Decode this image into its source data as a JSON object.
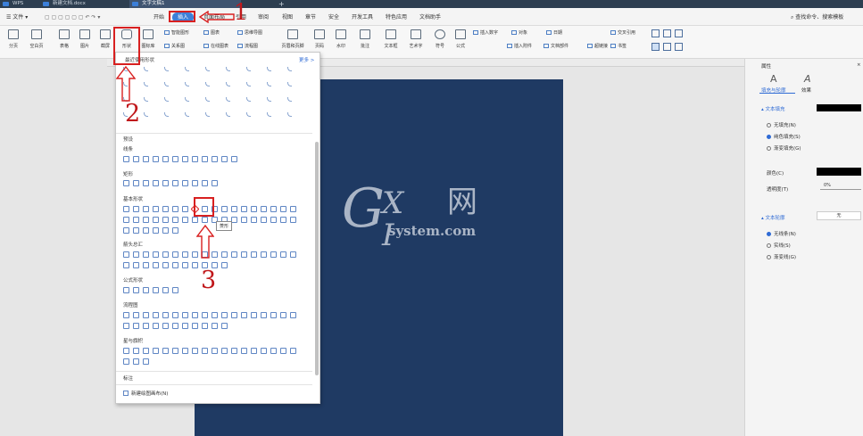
{
  "window_tabs": [
    "WPS",
    "新建文档.docx",
    "文字文稿1"
  ],
  "menu": {
    "file": "文件",
    "start": "开始",
    "insert": "插入",
    "layout": "页面布局",
    "reference": "引用",
    "review": "审阅",
    "view": "视图",
    "section": "章节",
    "security": "安全",
    "devtools": "开发工具",
    "special": "特色应用",
    "assistant": "文档助手",
    "search": "查找命令、搜索模板"
  },
  "ribbon": {
    "page_break": "分页",
    "blank_page": "空白页",
    "table": "表格",
    "picture": "图片",
    "screenshot": "截屏",
    "shapes": "形状",
    "icons": "图标库",
    "smart_shape": "智能图形",
    "chart": "图表",
    "mindmap": "思维导图",
    "relation": "关系图",
    "online_chart": "在线图表",
    "flowchart": "流程图",
    "header_footer": "页眉和页脚",
    "page_number": "页码",
    "watermark": "水印",
    "comment": "批注",
    "textbox": "文本框",
    "wordart": "艺术字",
    "symbol": "符号",
    "formula": "公式",
    "insert_number": "插入数字",
    "object": "对象",
    "date": "日期",
    "insert_attach": "插入附件",
    "doc_parts": "文档部件",
    "hyperlink": "超链接",
    "bookmark": "书签",
    "cross_ref": "交叉引用"
  },
  "shape_panel": {
    "recent": "最近使用形状",
    "more": "更多 >",
    "preset": "预设",
    "tooltip": "菱形",
    "new_canvas": "新建绘图画布(N)",
    "categories": [
      "线条",
      "矩形",
      "基本形状",
      "箭头总汇",
      "公式形状",
      "流程图",
      "星与旗帜",
      "标注"
    ]
  },
  "right_panel": {
    "title": "属性",
    "tab_fill": "填充与轮廓",
    "tab_effect": "效果",
    "fill_section": "文本填充",
    "no_fill": "无填充(N)",
    "solid_fill": "纯色填充(S)",
    "gradient_fill": "渐变填充(G)",
    "color_label": "颜色(C)",
    "transparency_label": "透明度(T)",
    "transparency_value": "0%",
    "outline_section": "文本轮廓",
    "outline_value": "无",
    "no_line": "无线条(N)",
    "solid_line": "实线(S)",
    "gradient_line": "渐变线(G)"
  },
  "watermark": {
    "g": "G",
    "xi": "X I",
    "cn": "网",
    "sub": "system.com"
  },
  "annotations": [
    "1",
    "2",
    "3"
  ],
  "colors": {
    "accent": "#3d7fd8",
    "doc_page": "#1f3a63",
    "annotation_red": "#d82020"
  }
}
